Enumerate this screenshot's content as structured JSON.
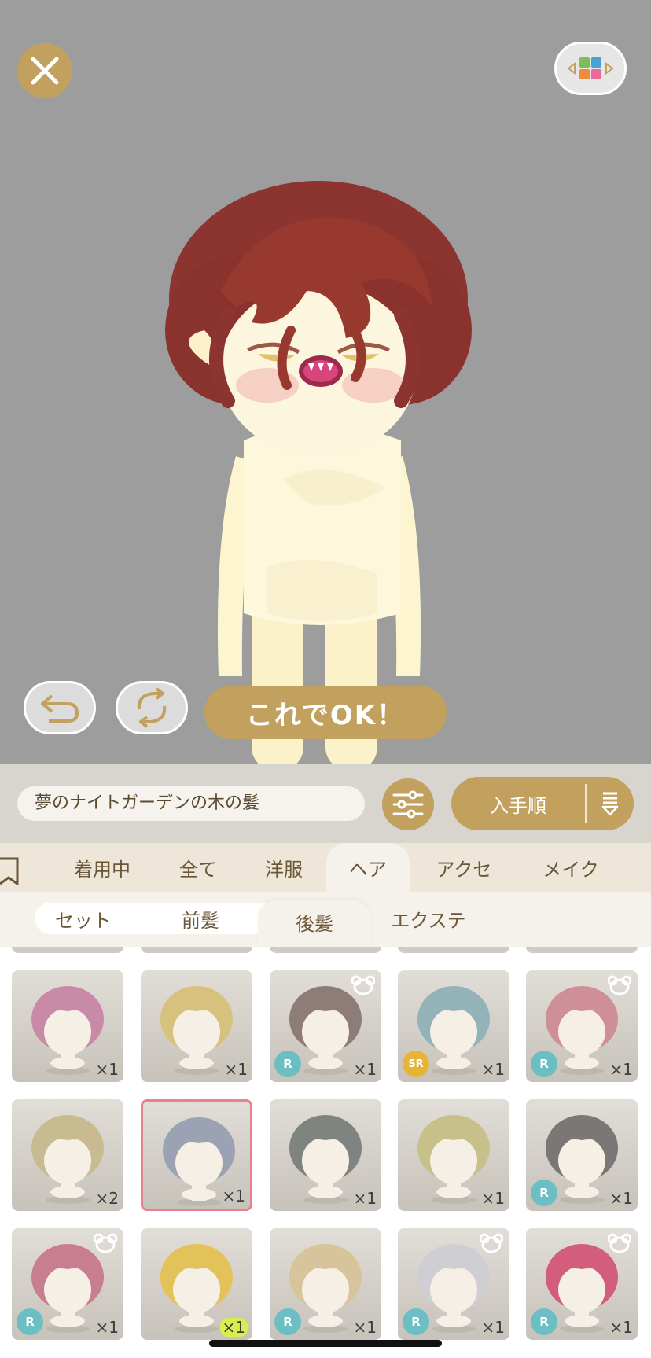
{
  "colors": {
    "accent": "#c2a15f",
    "stage_background": "#9d9d9d",
    "selected_border": "#e8808d",
    "rarity_r": "#6bbfc3",
    "rarity_sr": "#e7b438"
  },
  "header": {
    "close_icon": "close-icon",
    "palette_icon": "color-palette-icon"
  },
  "controls": {
    "undo_icon": "undo-icon",
    "rotate_icon": "rotate-icon",
    "ok_label": "これでOK！"
  },
  "toolbar": {
    "item_name": "夢のナイトガーデンの木の髪",
    "filter_icon": "sliders-icon",
    "sort_label": "入手順",
    "sort_icon": "sort-order-icon"
  },
  "tabs": [
    {
      "label": "着用中",
      "active": false
    },
    {
      "label": "全て",
      "active": false
    },
    {
      "label": "洋服",
      "active": false
    },
    {
      "label": "ヘア",
      "active": true
    },
    {
      "label": "アクセ",
      "active": false
    },
    {
      "label": "メイク",
      "active": false
    }
  ],
  "subtabs": [
    {
      "label": "セット",
      "active": false
    },
    {
      "label": "前髪",
      "active": false
    },
    {
      "label": "後髪",
      "active": true
    },
    {
      "label": "エクステ",
      "active": false
    }
  ],
  "items": [
    {
      "count": "×1",
      "rarity": "",
      "bear": false,
      "hair": "#c98aa8"
    },
    {
      "count": "×1",
      "rarity": "",
      "bear": false,
      "hair": "#d7c27d"
    },
    {
      "count": "×1",
      "rarity": "R",
      "bear": true,
      "hair": "#8d7c78"
    },
    {
      "count": "×1",
      "rarity": "SR",
      "bear": false,
      "hair": "#93b3b8"
    },
    {
      "count": "×1",
      "rarity": "R",
      "bear": true,
      "hair": "#cf8f98"
    },
    {
      "count": "×2",
      "rarity": "",
      "bear": false,
      "hair": "#c9bb90"
    },
    {
      "count": "×1",
      "rarity": "",
      "bear": false,
      "hair": "#9aa2b3",
      "selected": true
    },
    {
      "count": "×1",
      "rarity": "",
      "bear": false,
      "hair": "#7f8480"
    },
    {
      "count": "×1",
      "rarity": "",
      "bear": false,
      "hair": "#c8c08a"
    },
    {
      "count": "×1",
      "rarity": "R",
      "bear": false,
      "hair": "#7a7776"
    },
    {
      "count": "×1",
      "rarity": "R",
      "bear": true,
      "hair": "#c87d90"
    },
    {
      "count": "×1",
      "rarity": "",
      "bear": false,
      "hair": "#e4c25a",
      "highlight": true
    },
    {
      "count": "×1",
      "rarity": "R",
      "bear": false,
      "hair": "#d7c49a"
    },
    {
      "count": "×1",
      "rarity": "R",
      "bear": true,
      "hair": "#cfcfd3"
    },
    {
      "count": "×1",
      "rarity": "R",
      "bear": true,
      "hair": "#d25d7c"
    }
  ]
}
